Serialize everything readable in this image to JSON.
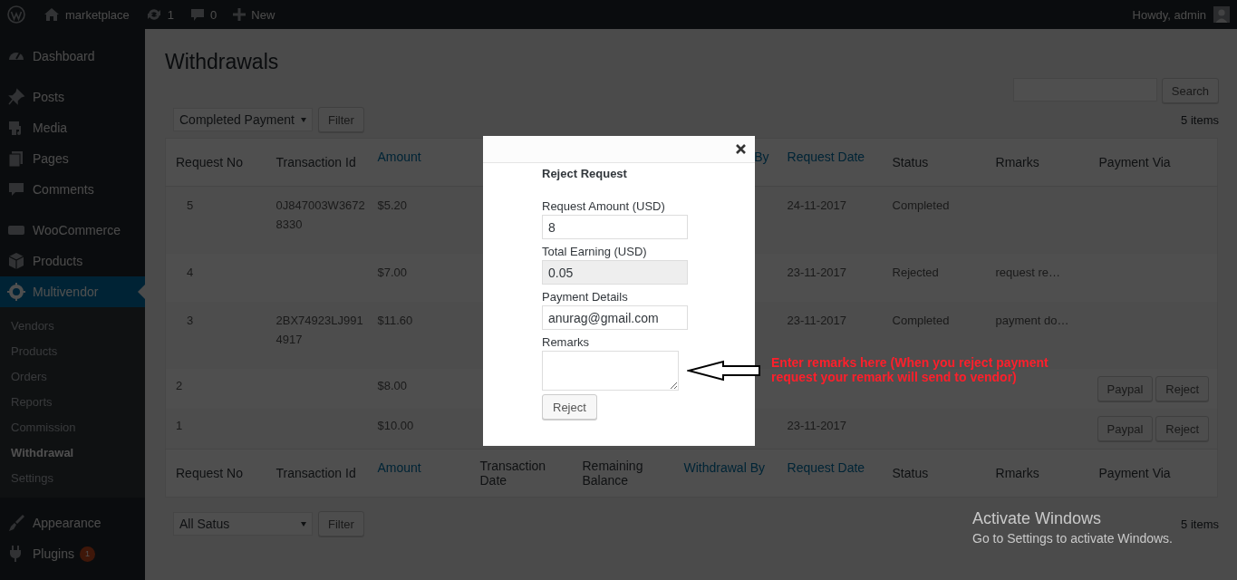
{
  "admin_bar": {
    "items": [
      {
        "kind": "logo"
      },
      {
        "kind": "site",
        "label": "marketplace"
      },
      {
        "kind": "updates",
        "label": "1"
      },
      {
        "kind": "comments",
        "label": "0"
      },
      {
        "kind": "new",
        "label": "New"
      }
    ],
    "greeting": "Howdy, admin"
  },
  "sidebar": {
    "groups": [
      [
        {
          "label": "Dashboard",
          "selected": false
        }
      ],
      [
        {
          "label": "Posts",
          "selected": false
        },
        {
          "label": "Media",
          "selected": false
        },
        {
          "label": "Pages",
          "selected": false
        },
        {
          "label": "Comments",
          "selected": false
        }
      ],
      [
        {
          "label": "WooCommerce",
          "selected": false
        },
        {
          "label": "Products",
          "selected": false
        },
        {
          "label": "Multivendor",
          "selected": true,
          "children": [
            {
              "label": "Vendors",
              "selected": false
            },
            {
              "label": "Products",
              "selected": false
            },
            {
              "label": "Orders",
              "selected": false
            },
            {
              "label": "Reports",
              "selected": false
            },
            {
              "label": "Commission",
              "selected": false
            },
            {
              "label": "Withdrawal",
              "selected": true
            },
            {
              "label": "Settings",
              "selected": false
            }
          ]
        }
      ],
      [
        {
          "label": "Appearance",
          "selected": false
        },
        {
          "label": "Plugins",
          "selected": false,
          "badge": "1"
        }
      ]
    ]
  },
  "page_title": "Withdrawals",
  "search": {
    "button": "Search"
  },
  "top_nav": {
    "filter_value": "Completed Payment",
    "filter_button": "Filter",
    "count": "5 items"
  },
  "table": {
    "header": [
      {
        "kind": "label",
        "label": "Request No",
        "sortable": false
      },
      {
        "kind": "label",
        "label": "Transaction Id",
        "sortable": false
      },
      {
        "kind": "label",
        "label": "Amount",
        "sortable": true
      },
      {
        "kind": "cut",
        "label": "By",
        "sortable": true
      },
      {
        "kind": "label",
        "label": "Request Date",
        "sortable": true
      },
      {
        "kind": "label",
        "label": "Status",
        "sortable": false
      },
      {
        "kind": "label",
        "label": "Rmarks",
        "sortable": false
      },
      {
        "kind": "label",
        "label": "Payment Via",
        "sortable": false
      }
    ],
    "rows": [
      {
        "request_no": "5",
        "transaction_id": "0J847003W36728330",
        "amount": "$5.20",
        "request_date": "24-11-2017",
        "status": "Completed"
      },
      {
        "request_no": "4",
        "amount": "$7.00",
        "request_date": "23-11-2017",
        "status": "Rejected",
        "remarks": "request re…"
      },
      {
        "request_no": "3",
        "transaction_id": "2BX74923LJ9914917",
        "amount": "$11.60",
        "request_date": "23-11-2017",
        "status": "Completed",
        "remarks": "payment do…"
      },
      {
        "request_no": "2",
        "amount": "$8.00",
        "actions": [
          "Paypal",
          "Reject"
        ]
      },
      {
        "request_no": "1",
        "amount": "$10.00",
        "request_date": "23-11-2017",
        "actions": [
          "Paypal",
          "Reject"
        ]
      }
    ],
    "footer": [
      {
        "label": "Request No",
        "sortable": false
      },
      {
        "label": "Transaction Id",
        "sortable": false
      },
      {
        "label": "Amount",
        "sortable": true
      },
      {
        "label": "Transaction Date",
        "sortable": false
      },
      {
        "label": "Remaining Balance",
        "sortable": false
      },
      {
        "label": "Withdrawal By",
        "sortable": true
      },
      {
        "label": "Request Date",
        "sortable": true
      },
      {
        "label": "Status",
        "sortable": false
      },
      {
        "label": "Rmarks",
        "sortable": false
      },
      {
        "label": "Payment Via",
        "sortable": false
      }
    ]
  },
  "bottom_nav": {
    "filter_value": "All Satus",
    "filter_button": "Filter",
    "count": "5 items"
  },
  "modal": {
    "title": "Reject Request",
    "fields": [
      {
        "kind": "input",
        "label": "Request Amount (USD)",
        "value": "8",
        "readonly": false
      },
      {
        "kind": "input",
        "label": "Total Earning (USD)",
        "value": "0.05",
        "readonly": true
      },
      {
        "kind": "input",
        "label": "Payment Details",
        "value": "anurag@gmail.com",
        "readonly": false
      },
      {
        "kind": "textarea",
        "label": "Remarks",
        "readonly": false
      }
    ],
    "button": "Reject"
  },
  "annotation": {
    "text": "Enter remarks here (When you reject payment request your remark will send to vendor)"
  },
  "os_notice": {
    "title": "Activate Windows",
    "text": "Go to Settings to activate Windows."
  }
}
